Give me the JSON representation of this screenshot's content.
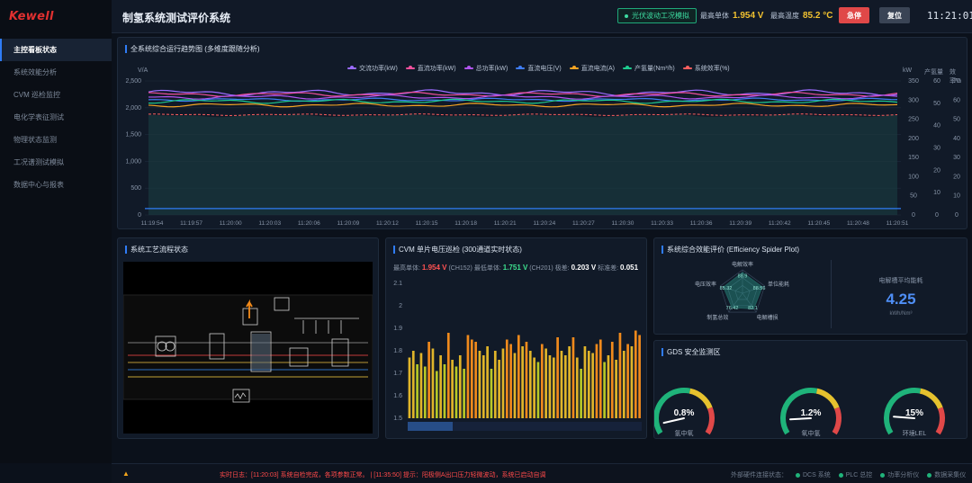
{
  "brand": "Kewell",
  "header": {
    "title": "制氢系统测试评价系统",
    "mode": "光伏波动工况模拟",
    "max_cell_label": "最高单体",
    "max_cell_value": "1.954 V",
    "max_temp_label": "最高温度",
    "max_temp_value": "85.2 °C",
    "stop_label": "急停",
    "reset_label": "复位",
    "time": "11:21:01"
  },
  "sidebar": {
    "items": [
      {
        "label": "主控看板状态"
      },
      {
        "label": "系统效能分析"
      },
      {
        "label": "CVM 巡检监控"
      },
      {
        "label": "电化学表征测试"
      },
      {
        "label": "物理状态监测"
      },
      {
        "label": "工况谱测试模拟"
      },
      {
        "label": "数据中心与报表"
      }
    ]
  },
  "trend": {
    "title": "全系统综合运行趋势图 (多维度跟随分析)",
    "y_left_unit": "V/A",
    "y_kw_unit": "kW",
    "y_h2_unit": "产氢量",
    "y_eff_unit": "效率%",
    "legend": [
      {
        "name": "交流功率(kW)",
        "color": "#9b6bff"
      },
      {
        "name": "直流功率(kW)",
        "color": "#f0509c"
      },
      {
        "name": "总功率(kW)",
        "color": "#b054ef"
      },
      {
        "name": "直流电压(V)",
        "color": "#3f7cf2"
      },
      {
        "name": "直流电流(A)",
        "color": "#f3a323"
      },
      {
        "name": "产氢量(Nm³/h)",
        "color": "#1ecb8f"
      },
      {
        "name": "系统效率(%)",
        "color": "#ff5f5f"
      }
    ],
    "y_ticks": [
      "2,500",
      "2,000",
      "1,500",
      "1,000",
      "500",
      "0"
    ],
    "kw_ticks": [
      "350",
      "300",
      "250",
      "200",
      "150",
      "100",
      "50",
      "0"
    ],
    "h2_ticks": [
      "60",
      "50",
      "40",
      "30",
      "20",
      "10",
      "0"
    ],
    "eff_ticks": [
      "70",
      "60",
      "50",
      "40",
      "30",
      "20",
      "10",
      "0"
    ],
    "x_ticks": [
      "11:19:54",
      "11:19:57",
      "11:20:00",
      "11:20:03",
      "11:20:06",
      "11:20:09",
      "11:20:12",
      "11:20:15",
      "11:20:18",
      "11:20:21",
      "11:20:24",
      "11:20:27",
      "11:20:30",
      "11:20:33",
      "11:20:36",
      "11:20:39",
      "11:20:42",
      "11:20:45",
      "11:20:48",
      "11:20:51"
    ]
  },
  "flow": {
    "title": "系统工艺流程状态"
  },
  "cvm": {
    "title": "CVM 单片电压巡检 (300通道实时状态)",
    "max_label": "最高单体:",
    "max_value": "1.954 V",
    "max_ch": "(CH152)",
    "min_label": "最低单体:",
    "min_value": "1.751 V",
    "min_ch": "(CH201)",
    "diff_label": "极差:",
    "diff_value": "0.203 V",
    "std_label": "标准差:",
    "std_value": "0.051",
    "y_ticks": [
      "2.1",
      "2",
      "1.9",
      "1.8",
      "1.7",
      "1.6",
      "1.5"
    ]
  },
  "eff": {
    "title": "系统综合效能评价 (Efficiency Spider Plot)",
    "axes": [
      "电解效率",
      "单位能耗",
      "电解槽损",
      "制氢总效",
      "电压效率"
    ],
    "values": [
      "88.9",
      "88.56",
      "82.1",
      "76.42",
      "85.32"
    ],
    "metric_label": "电解槽平均能耗",
    "metric_value": "4.25",
    "metric_unit": "kWh/Nm³"
  },
  "gds": {
    "title": "GDS 安全监测区",
    "gauges": [
      {
        "label": "氢中氧",
        "value": "0.8%",
        "pct": 0.08
      },
      {
        "label": "氧中氢",
        "value": "1.2%",
        "pct": 0.12
      },
      {
        "label": "环境LEL",
        "value": "15%",
        "pct": 0.15
      }
    ]
  },
  "footer": {
    "log": "实时日志：[11:20:03] 系统自检完成，各项参数正常。 | [11:35:50] 提示：阳极侧A出口压力轻微波动，系统已启动自调",
    "conn_label": "外部硬件连接状态：",
    "conns": [
      "DCS 系统",
      "PLC 总控",
      "功率分析仪",
      "数据采集仪"
    ]
  }
}
